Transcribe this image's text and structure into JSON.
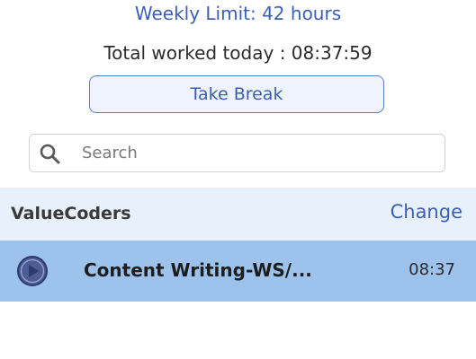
{
  "header": {
    "weekly_limit": "Weekly Limit: 42 hours",
    "total_worked": "Total worked today : 08:37:59"
  },
  "break_button": {
    "label": "Take Break"
  },
  "search": {
    "placeholder": "Search",
    "value": "",
    "icon": "search-icon"
  },
  "organization": {
    "name": "ValueCoders",
    "change_label": "Change"
  },
  "projects": [
    {
      "name": "Content Writing-WS/...",
      "time": "08:37",
      "icon": "play-icon",
      "selected": true
    }
  ],
  "colors": {
    "accent": "#3c5fb5",
    "org_bar_bg": "#e8f0fb",
    "selected_row_bg": "#9dc3ed",
    "button_bg": "#eef3fd"
  }
}
